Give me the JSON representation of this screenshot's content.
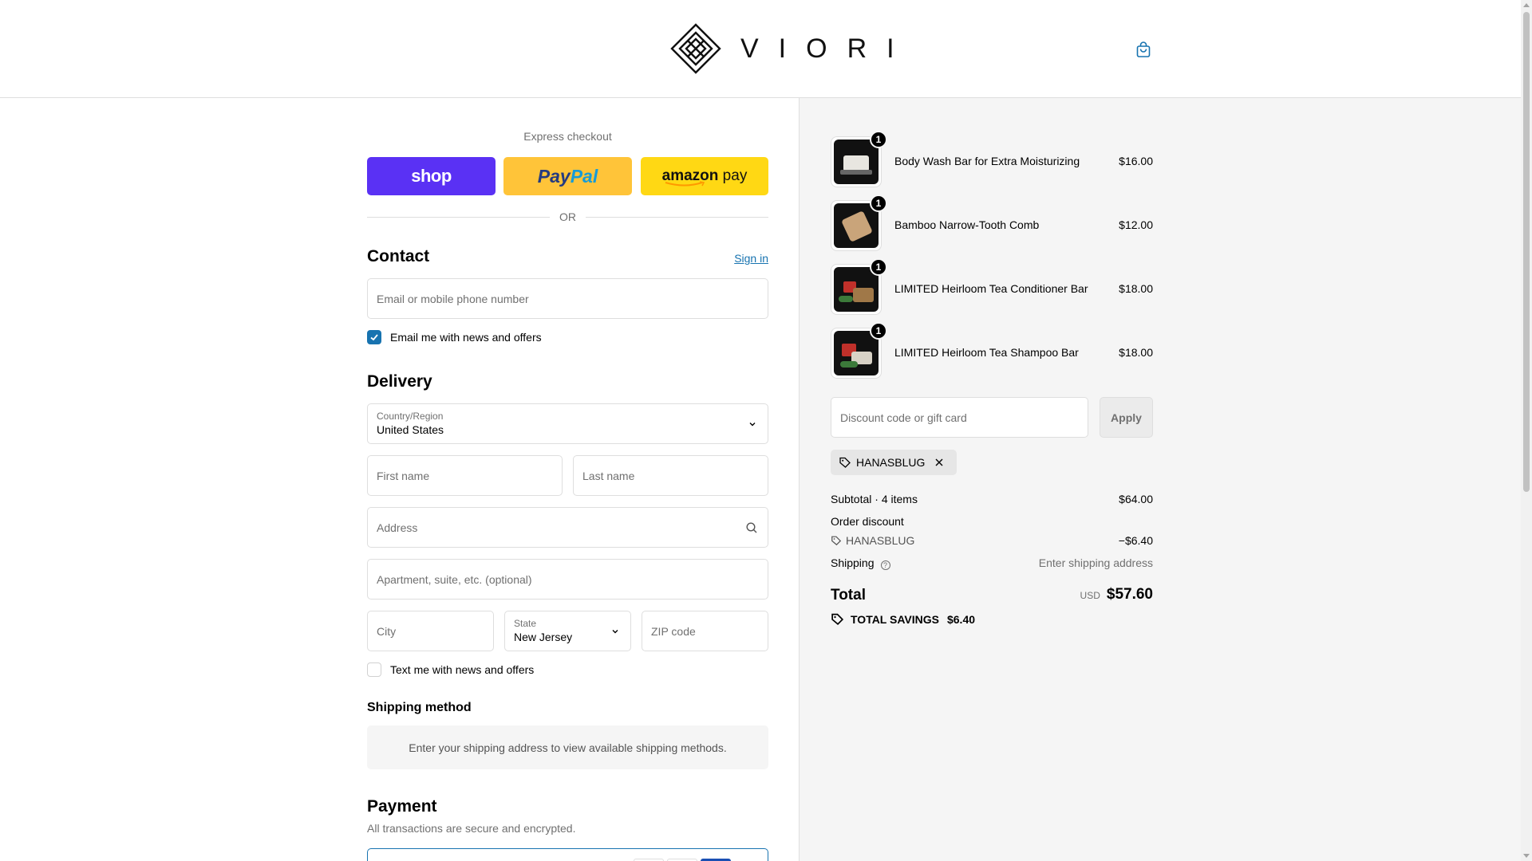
{
  "header": {
    "brand": "VIORI"
  },
  "express": {
    "title": "Express checkout",
    "shop_label": "shop",
    "paypal_label_1": "Pay",
    "paypal_label_2": "Pal",
    "amazon_label_1": "amazon",
    "amazon_label_2": " pay",
    "or_label": "OR"
  },
  "contact": {
    "heading": "Contact",
    "signin": "Sign in",
    "email_placeholder": "Email or mobile phone number",
    "news_label": "Email me with news and offers",
    "news_checked": true
  },
  "delivery": {
    "heading": "Delivery",
    "country_label": "Country/Region",
    "country_value": "United States",
    "first_name": "First name",
    "last_name": "Last name",
    "address": "Address",
    "apartment": "Apartment, suite, etc. (optional)",
    "city": "City",
    "state_label": "State",
    "state_value": "New Jersey",
    "zip": "ZIP code",
    "text_label": "Text me with news and offers",
    "text_checked": false
  },
  "shipping_method": {
    "heading": "Shipping method",
    "message": "Enter your shipping address to view available shipping methods."
  },
  "payment": {
    "heading": "Payment",
    "subtitle": "All transactions are secure and encrypted."
  },
  "cart": {
    "items": [
      {
        "name": "Body Wash Bar for Extra Moisturizing",
        "price": "$16.00",
        "qty": "1"
      },
      {
        "name": "Bamboo Narrow-Tooth Comb",
        "price": "$12.00",
        "qty": "1"
      },
      {
        "name": "LIMITED Heirloom Tea Conditioner Bar",
        "price": "$18.00",
        "qty": "1"
      },
      {
        "name": "LIMITED Heirloom Tea Shampoo Bar",
        "price": "$18.00",
        "qty": "1"
      }
    ],
    "discount_placeholder": "Discount code or gift card",
    "apply_label": "Apply",
    "applied_code": "HANASBLUG",
    "subtotal_label": "Subtotal · 4 items",
    "subtotal_value": "$64.00",
    "order_discount_label": "Order discount",
    "discount_code": "HANASBLUG",
    "discount_value": "−$6.40",
    "shipping_label": "Shipping",
    "shipping_value": "Enter shipping address",
    "total_label": "Total",
    "currency": "USD",
    "total_value": "$57.60",
    "savings_label": "TOTAL SAVINGS",
    "savings_value": "$6.40"
  },
  "colors": {
    "accent": "#1773b0",
    "shop_pay": "#5a31f4",
    "paypal": "#ffc439",
    "amazon": "#ffd814"
  }
}
